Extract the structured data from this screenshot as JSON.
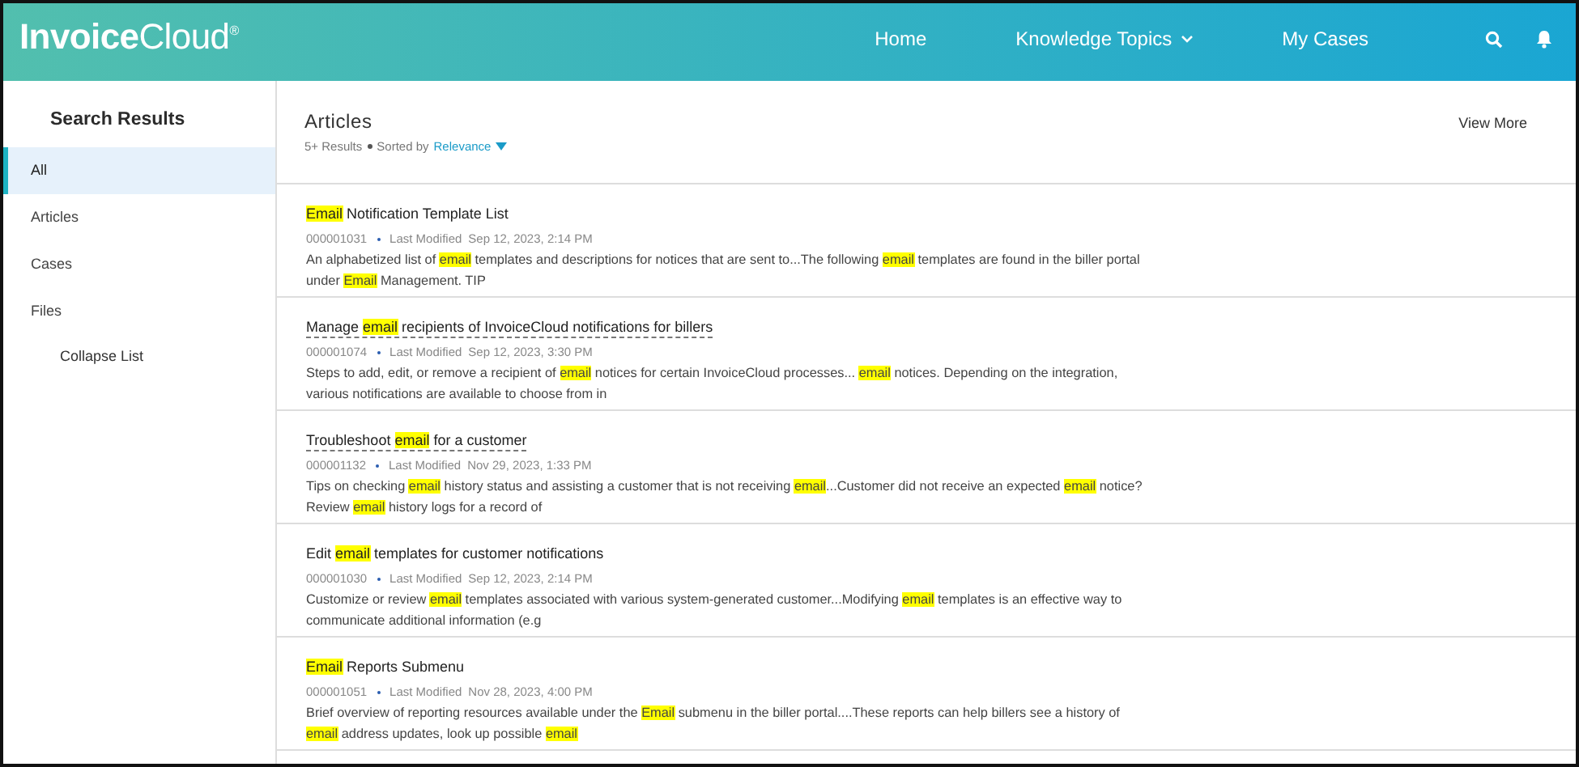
{
  "header": {
    "logo": "**Invoice**Cloud$^{®}$",
    "nav": [
      {
        "label": "Home",
        "has_menu": false
      },
      {
        "label": "Knowledge Topics",
        "has_menu": true
      },
      {
        "label": "My Cases",
        "has_menu": false
      }
    ]
  },
  "sidebar": {
    "title": "Search Results",
    "items": [
      {
        "label": "All",
        "selected": true
      },
      {
        "label": "Articles",
        "selected": false
      },
      {
        "label": "Cases",
        "selected": false
      },
      {
        "label": "Files",
        "selected": false
      }
    ],
    "collapse_link": "Collapse List"
  },
  "results": {
    "title": "Articles",
    "count": "5+ Results",
    "sort_label": "Sorted by",
    "sort_value": "Relevance",
    "view_more": "View More",
    "articles": [
      {
        "title": [
          {
            "text": "Email",
            "highlight": true
          },
          {
            "text": " Notification Template List",
            "highlight": false
          }
        ],
        "underlined": false,
        "number": "000001031",
        "modified_label": "Last Modified",
        "date": "Sep 12, 2023, 2:14 PM",
        "description": [
          {
            "text": "An alphabetized list of ",
            "highlight": false
          },
          {
            "text": "email",
            "highlight": true
          },
          {
            "text": " templates and descriptions for notices that are sent to...The following ",
            "highlight": false
          },
          {
            "text": "email",
            "highlight": true
          },
          {
            "text": " templates are found in the biller portal under ",
            "highlight": false
          },
          {
            "text": "Email",
            "highlight": true
          },
          {
            "text": " Management. TIP",
            "highlight": false
          }
        ]
      },
      {
        "title": [
          {
            "text": "Manage ",
            "highlight": false
          },
          {
            "text": "email",
            "highlight": true
          },
          {
            "text": " recipients of InvoiceCloud notifications for billers",
            "highlight": false
          }
        ],
        "underlined": true,
        "number": "000001074",
        "modified_label": "Last Modified",
        "date": "Sep 12, 2023, 3:30 PM",
        "description": [
          {
            "text": "Steps to add, edit, or remove a recipient of ",
            "highlight": false
          },
          {
            "text": "email",
            "highlight": true
          },
          {
            "text": " notices for certain InvoiceCloud processes... ",
            "highlight": false
          },
          {
            "text": "email",
            "highlight": true
          },
          {
            "text": " notices. Depending on the integration, various notifications are available to choose from in",
            "highlight": false
          }
        ]
      },
      {
        "title": [
          {
            "text": "Troubleshoot ",
            "highlight": false
          },
          {
            "text": "email",
            "highlight": true
          },
          {
            "text": " for a customer",
            "highlight": false
          }
        ],
        "underlined": true,
        "number": "000001132",
        "modified_label": "Last Modified",
        "date": "Nov 29, 2023, 1:33 PM",
        "description": [
          {
            "text": "Tips on checking ",
            "highlight": false
          },
          {
            "text": "email",
            "highlight": true
          },
          {
            "text": " history status and assisting a customer that is not receiving ",
            "highlight": false
          },
          {
            "text": "email",
            "highlight": true
          },
          {
            "text": "...Customer did not receive an expected ",
            "highlight": false
          },
          {
            "text": "email",
            "highlight": true
          },
          {
            "text": " notice? Review ",
            "highlight": false
          },
          {
            "text": "email",
            "highlight": true
          },
          {
            "text": " history logs for a record of",
            "highlight": false
          }
        ]
      },
      {
        "title": [
          {
            "text": "Edit ",
            "highlight": false
          },
          {
            "text": "email",
            "highlight": true
          },
          {
            "text": " templates for customer notifications",
            "highlight": false
          }
        ],
        "underlined": false,
        "number": "000001030",
        "modified_label": "Last Modified",
        "date": "Sep 12, 2023, 2:14 PM",
        "description": [
          {
            "text": "Customize or review ",
            "highlight": false
          },
          {
            "text": "email",
            "highlight": true
          },
          {
            "text": " templates associated with various system-generated customer...Modifying ",
            "highlight": false
          },
          {
            "text": "email",
            "highlight": true
          },
          {
            "text": " templates is an effective way to communicate additional information (e.g",
            "highlight": false
          }
        ]
      },
      {
        "title": [
          {
            "text": "Email",
            "highlight": true
          },
          {
            "text": " Reports Submenu",
            "highlight": false
          }
        ],
        "underlined": false,
        "number": "000001051",
        "modified_label": "Last Modified",
        "date": "Nov 28, 2023, 4:00 PM",
        "description": [
          {
            "text": "Brief overview of reporting resources available under the ",
            "highlight": false
          },
          {
            "text": "Email",
            "highlight": true
          },
          {
            "text": " submenu in the biller portal....These reports can help billers see a history of ",
            "highlight": false
          },
          {
            "text": "email",
            "highlight": true
          },
          {
            "text": " address updates, look up possible ",
            "highlight": false
          },
          {
            "text": "email",
            "highlight": true
          }
        ]
      }
    ]
  }
}
